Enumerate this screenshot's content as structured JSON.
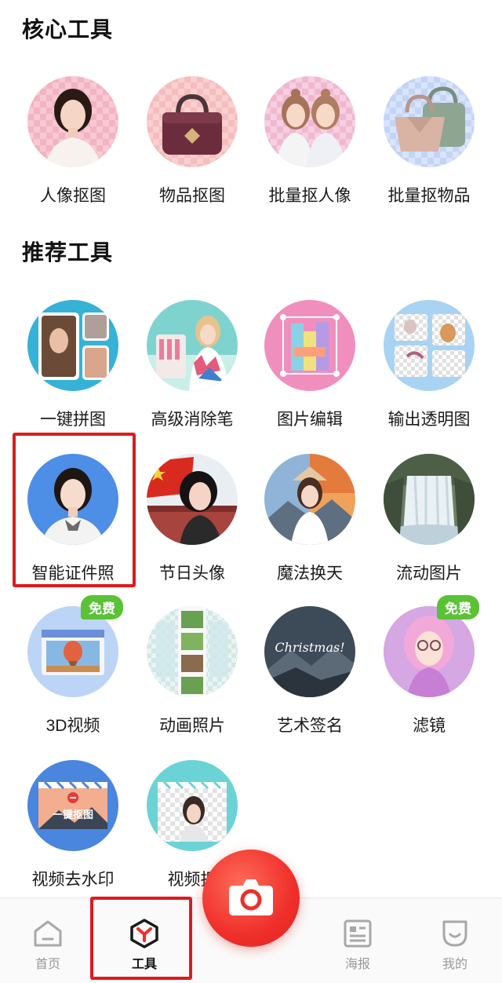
{
  "core": {
    "title": "核心工具",
    "items": [
      {
        "label": "人像抠图",
        "icon": "portrait-cutout-icon"
      },
      {
        "label": "物品抠图",
        "icon": "handbag-cutout-icon"
      },
      {
        "label": "批量抠人像",
        "icon": "batch-portrait-icon"
      },
      {
        "label": "批量抠物品",
        "icon": "batch-object-icon"
      }
    ]
  },
  "recommended": {
    "title": "推荐工具",
    "items": [
      {
        "label": "一键拼图",
        "icon": "collage-icon"
      },
      {
        "label": "高级消除笔",
        "icon": "eraser-pen-icon"
      },
      {
        "label": "图片编辑",
        "icon": "image-edit-icon"
      },
      {
        "label": "输出透明图",
        "icon": "transparent-output-icon"
      },
      {
        "label": "智能证件照",
        "icon": "id-photo-icon"
      },
      {
        "label": "节日头像",
        "icon": "festival-avatar-icon"
      },
      {
        "label": "魔法换天",
        "icon": "sky-replace-icon"
      },
      {
        "label": "流动图片",
        "icon": "waterfall-motion-icon"
      },
      {
        "label": "3D视频",
        "icon": "3d-video-icon",
        "badge": "免费"
      },
      {
        "label": "动画照片",
        "icon": "animated-photo-icon"
      },
      {
        "label": "艺术签名",
        "icon": "art-signature-icon",
        "sig_text": "Christmas!"
      },
      {
        "label": "滤镜",
        "icon": "filter-icon",
        "badge": "免费"
      },
      {
        "label": "视频去水印",
        "icon": "video-watermark-icon",
        "overlay_text": "一键抠图"
      },
      {
        "label": "视频抠",
        "icon": "video-cutout-icon"
      }
    ]
  },
  "tabbar": {
    "items": [
      {
        "label": "首页",
        "icon": "home-icon"
      },
      {
        "label": "工具",
        "icon": "tools-icon",
        "active": true
      },
      {
        "label": "海报",
        "icon": "poster-icon"
      },
      {
        "label": "我的",
        "icon": "profile-icon"
      }
    ],
    "camera_icon": "camera-icon"
  },
  "colors": {
    "accent": "#ef2f2a",
    "badge": "#5bc236",
    "highlight": "#e0191d"
  }
}
